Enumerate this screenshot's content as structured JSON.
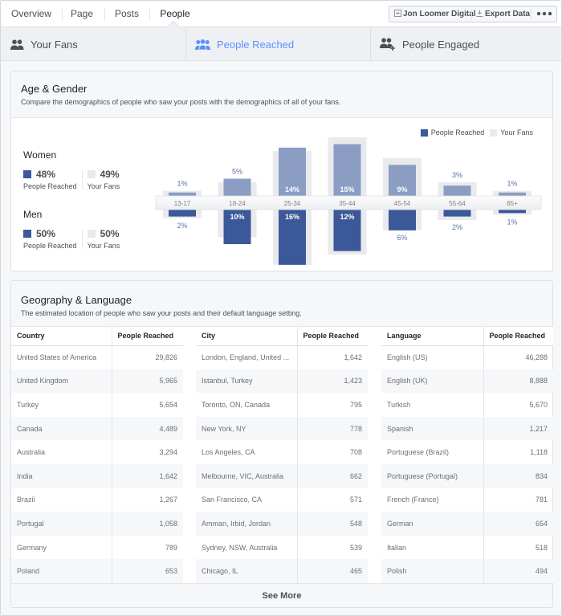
{
  "nav": {
    "tabs": [
      {
        "label": "Overview",
        "active": false
      },
      {
        "label": "Page",
        "active": false
      },
      {
        "label": "Posts",
        "active": false
      },
      {
        "label": "People",
        "active": true
      }
    ],
    "toolbar": {
      "page_name": "Jon Loomer Digital",
      "page_icon": "switch-page-icon",
      "export_label": "Export Data",
      "export_icon": "download-icon",
      "more_icon": "more-dots-icon"
    }
  },
  "subtabs": [
    {
      "label": "Your Fans",
      "icon": "fans-icon",
      "active": false
    },
    {
      "label": "People Reached",
      "icon": "people-reached-icon",
      "active": true
    },
    {
      "label": "People Engaged",
      "icon": "people-engaged-icon",
      "active": false
    }
  ],
  "colors": {
    "reached_women": "#8b9dc3",
    "reached_men": "#3b5998",
    "fans": "#e9eaed",
    "accent": "#5890ff"
  },
  "age_gender": {
    "title": "Age & Gender",
    "subtitle": "Compare the demographics of people who saw your posts with the demographics of all of your fans.",
    "legend": {
      "reached": "People Reached",
      "fans": "Your Fans"
    },
    "women": {
      "title": "Women",
      "reached_pct": "48%",
      "fans_pct": "49%",
      "reached_label": "People Reached",
      "fans_label": "Your Fans"
    },
    "men": {
      "title": "Men",
      "reached_pct": "50%",
      "fans_pct": "50%",
      "reached_label": "People Reached",
      "fans_label": "Your Fans"
    }
  },
  "chart_data": {
    "type": "bar",
    "title": "Age & Gender",
    "categories": [
      "13-17",
      "18-24",
      "25-34",
      "35-44",
      "45-54",
      "55-64",
      "65+"
    ],
    "series": [
      {
        "name": "Women - People Reached",
        "values": [
          1,
          5,
          14,
          15,
          9,
          3,
          1
        ]
      },
      {
        "name": "Men - People Reached",
        "values": [
          2,
          10,
          16,
          12,
          6,
          2,
          1
        ]
      },
      {
        "name": "Women - Your Fans",
        "values": [
          1.5,
          4,
          13,
          17,
          11,
          4,
          1.5
        ]
      },
      {
        "name": "Men - Your Fans",
        "values": [
          2.5,
          8,
          16,
          13,
          6,
          3,
          1.5
        ]
      }
    ],
    "labels": {
      "women": [
        "1%",
        "5%",
        "14%",
        "15%",
        "9%",
        "3%",
        "1%"
      ],
      "men": [
        "2%",
        "10%",
        "16%",
        "12%",
        "6%",
        "2%",
        "1%"
      ]
    },
    "legend": [
      "People Reached",
      "Your Fans"
    ],
    "legend_position": "top-right",
    "xlabel": "",
    "ylabel": "",
    "ylim": [
      0,
      18
    ]
  },
  "geo": {
    "title": "Geography & Language",
    "subtitle": "The estimated location of people who saw your posts and their default language setting.",
    "see_more": "See More",
    "tables": [
      {
        "headers": [
          "Country",
          "People Reached"
        ],
        "rows": [
          [
            "United States of America",
            "29,826"
          ],
          [
            "United Kingdom",
            "5,965"
          ],
          [
            "Turkey",
            "5,654"
          ],
          [
            "Canada",
            "4,489"
          ],
          [
            "Australia",
            "3,294"
          ],
          [
            "India",
            "1,642"
          ],
          [
            "Brazil",
            "1,267"
          ],
          [
            "Portugal",
            "1,058"
          ],
          [
            "Germany",
            "789"
          ],
          [
            "Poland",
            "653"
          ]
        ]
      },
      {
        "headers": [
          "City",
          "People Reached"
        ],
        "rows": [
          [
            "London, England, United ...",
            "1,642"
          ],
          [
            "Istanbul, Turkey",
            "1,423"
          ],
          [
            "Toronto, ON, Canada",
            "795"
          ],
          [
            "New York, NY",
            "778"
          ],
          [
            "Los Angeles, CA",
            "708"
          ],
          [
            "Melbourne, VIC, Australia",
            "662"
          ],
          [
            "San Francisco, CA",
            "571"
          ],
          [
            "Amman, Irbid, Jordan",
            "548"
          ],
          [
            "Sydney, NSW, Australia",
            "539"
          ],
          [
            "Chicago, IL",
            "465"
          ]
        ]
      },
      {
        "headers": [
          "Language",
          "People Reached"
        ],
        "rows": [
          [
            "English (US)",
            "46,288"
          ],
          [
            "English (UK)",
            "8,888"
          ],
          [
            "Turkish",
            "5,670"
          ],
          [
            "Spanish",
            "1,217"
          ],
          [
            "Portuguese (Brazil)",
            "1,118"
          ],
          [
            "Portuguese (Portugal)",
            "834"
          ],
          [
            "French (France)",
            "781"
          ],
          [
            "German",
            "654"
          ],
          [
            "Italian",
            "518"
          ],
          [
            "Polish",
            "494"
          ]
        ]
      }
    ]
  }
}
